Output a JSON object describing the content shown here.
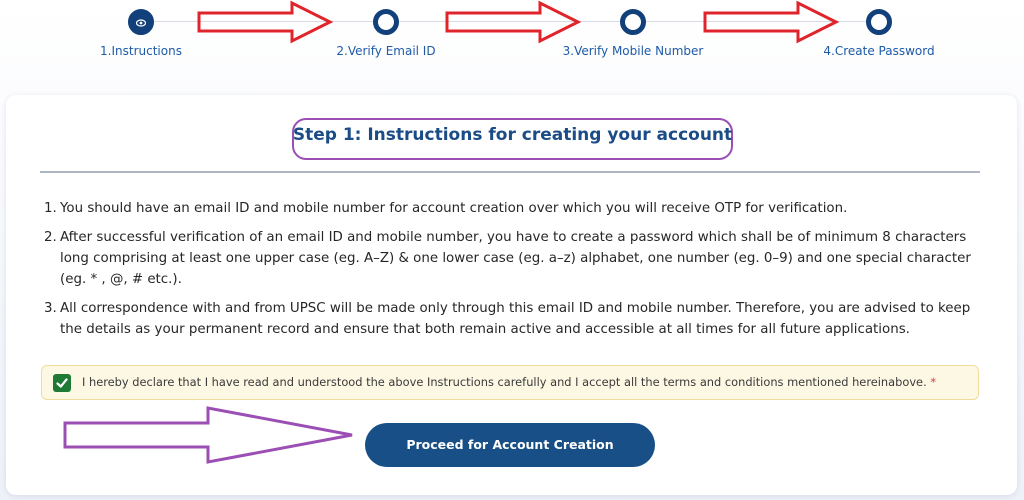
{
  "stepper": {
    "steps": [
      {
        "label": "1.Instructions",
        "active": true
      },
      {
        "label": "2.Verify Email ID",
        "active": false
      },
      {
        "label": "3.Verify Mobile Number",
        "active": false
      },
      {
        "label": "4.Create Password",
        "active": false
      }
    ]
  },
  "card": {
    "title": "Step 1: Instructions for creating your account",
    "instructions": [
      {
        "num": "1.",
        "text": "You should have an email ID and mobile number for account creation over which you will receive OTP for verification."
      },
      {
        "num": "2.",
        "text": "After successful verification of an email ID and mobile number, you have to create a password which shall be of minimum 8 characters long comprising at least one upper case (eg. A–Z) & one lower case (eg. a–z) alphabet, one number (eg. 0–9) and one special character (eg. * , @, # etc.)."
      },
      {
        "num": "3.",
        "text": "All correspondence with and from UPSC will be made only through this email ID and mobile number. Therefore, you are advised to keep the details as your permanent record and ensure that both remain active and accessible at all times for all future applications."
      }
    ],
    "declaration": {
      "text": "I hereby declare that I have read and understood the above Instructions carefully and I accept all the terms and conditions mentioned hereinabove.",
      "required_mark": "*",
      "checked": true
    },
    "proceed_label": "Proceed for Account Creation"
  },
  "colors": {
    "primary": "#184f86",
    "step_label": "#1e5aa8",
    "annotation_red": "#e0242b",
    "annotation_purple": "#9b4fb5",
    "checkbox_green": "#1f7a36",
    "declare_bg": "#fdf8e4"
  },
  "icons": {
    "active_step": "eye-icon",
    "checkbox": "checkmark-icon"
  }
}
